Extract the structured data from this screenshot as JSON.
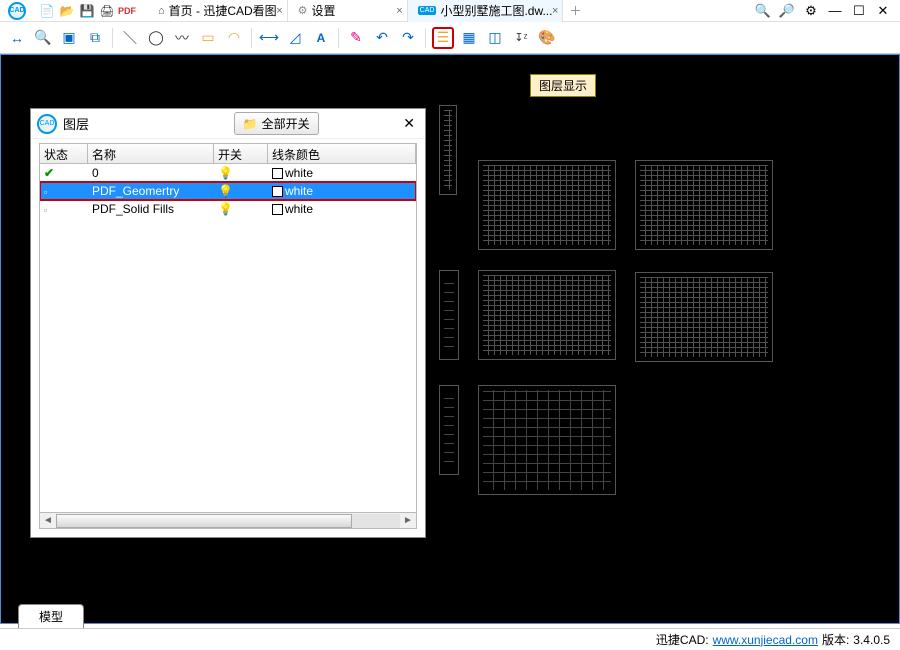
{
  "quicktools": {
    "new": "new",
    "open": "open",
    "save": "save",
    "print": "print",
    "pdf": "pdf"
  },
  "tabs": {
    "home": {
      "label": "首页 - 迅捷CAD看图"
    },
    "settings": {
      "label": "设置"
    },
    "file": {
      "label": "小型别墅施工图.dw..."
    }
  },
  "tooltip": {
    "text": "图层显示"
  },
  "dialog": {
    "title": "图层",
    "toggle_all": "全部开关",
    "headers": {
      "state": "状态",
      "name": "名称",
      "on": "开关",
      "color": "线条颜色"
    },
    "rows": [
      {
        "name": "0",
        "color": "white",
        "selected": false,
        "current": true
      },
      {
        "name": "PDF_Geomertry",
        "color": "white",
        "selected": true,
        "current": false
      },
      {
        "name": "PDF_Solid Fills",
        "color": "white",
        "selected": false,
        "current": false
      }
    ]
  },
  "bottom": {
    "model": "模型"
  },
  "status": {
    "product": "迅捷CAD:",
    "url": "www.xunjiecad.com",
    "version_label": "版本:",
    "version": "3.4.0.5"
  },
  "colors": {
    "accent": "#0099e5",
    "highlight_border": "#c00"
  }
}
